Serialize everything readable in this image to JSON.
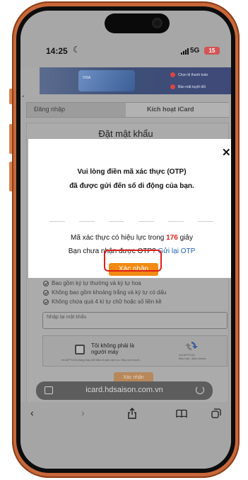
{
  "status_bar": {
    "time": "14:25",
    "network": "5G",
    "battery": "15",
    "moon_icon": "moon-icon",
    "signal_icon": "signal-bars-icon"
  },
  "banner": {
    "card_text": "VISA",
    "line1": "Chọn lệ thanh toán",
    "line2": "Bảo mật tuyệt đối"
  },
  "tabs": {
    "login": "Đăng nhập",
    "activate": "Kích hoạt iCard"
  },
  "page": {
    "heading": "Đặt mật khẩu",
    "requirements": [
      "Bao gồm ký tự thường và ký tự hoa",
      "Không bao gồm khoảng trắng và ký tự có dấu",
      "Không chứa quá 4 kí tự chữ hoặc số liền kề"
    ],
    "confirm_password_placeholder": "Nhập lại mật khẩu",
    "submit_label": "Xác nhận"
  },
  "recaptcha": {
    "label": "Tôi không phải là người máy",
    "terms": "reCAPTCHA đang thay đổi điều khoản dịch vụ. Hãy xem hành...",
    "brand": "reCAPTCHA",
    "brand_sub": "Bảo mật - Điều khoản"
  },
  "browser": {
    "url": "icard.hdsaison.com.vn",
    "toolbar_icons": [
      "back-icon",
      "forward-icon",
      "share-icon",
      "bookmarks-icon",
      "tabs-icon"
    ]
  },
  "modal": {
    "title_line1": "Vui lòng điền mã xác thực (OTP)",
    "title_line2": "đã được gửi đến số di động của bạn.",
    "otp_slots": 6,
    "validity_prefix": "Mã xác thực có hiệu lực trong ",
    "validity_seconds": "176",
    "validity_suffix": " giây",
    "resend_prompt": "Bạn chưa nhận được OTP? ",
    "resend_link": "Gửi lại OTP",
    "confirm_label": "Xác nhận",
    "close_icon": "close-icon",
    "accent_color": "#f28a14",
    "highlight_color": "#e0201a",
    "countdown_color": "#e0221c"
  }
}
